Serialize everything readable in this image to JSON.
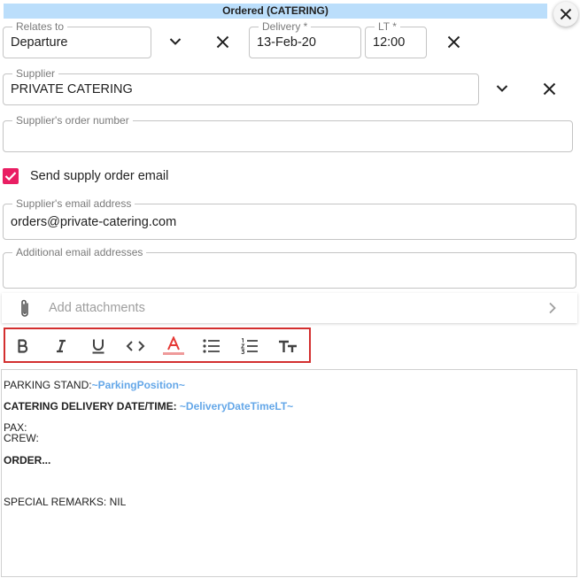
{
  "header": {
    "title": "Ordered (CATERING)"
  },
  "relates_to": {
    "label": "Relates to",
    "value": "Departure"
  },
  "delivery": {
    "label": "Delivery *",
    "value": "13-Feb-20"
  },
  "lt": {
    "label": "LT *",
    "value": "12:00"
  },
  "supplier": {
    "label": "Supplier",
    "value": "PRIVATE CATERING"
  },
  "supplier_order_number": {
    "label": "Supplier's order number",
    "value": ""
  },
  "send_email": {
    "label": "Send supply order email",
    "checked": true
  },
  "supplier_email": {
    "label": "Supplier's email address",
    "value": "orders@private-catering.com"
  },
  "additional_emails": {
    "label": "Additional email addresses",
    "value": ""
  },
  "attachments": {
    "label": "Add attachments"
  },
  "toolbar": {
    "buttons": [
      "bold",
      "italic",
      "underline",
      "code",
      "text-color",
      "bulleted-list",
      "numbered-list",
      "text-size"
    ]
  },
  "editor": {
    "parking_label": "PARKING STAND:",
    "parking_placeholder": "~ParkingPosition~",
    "catering_label": "CATERING DELIVERY DATE/TIME: ",
    "catering_placeholder": "~DeliveryDateTimeLT~",
    "pax": "PAX:",
    "crew": "CREW:",
    "order": "ORDER...",
    "remarks": "SPECIAL REMARKS: NIL"
  },
  "colors": {
    "accent": "#e91e63",
    "header_bg": "#bbdefb",
    "highlight_border": "#d32f2f",
    "placeholder_text": "#64a7e8"
  }
}
